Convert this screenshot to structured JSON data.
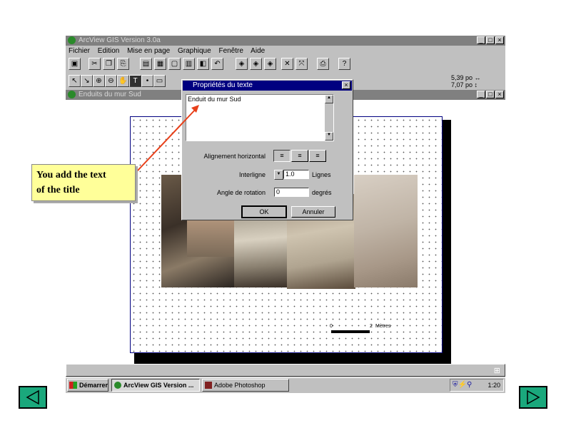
{
  "app": {
    "title": "ArcView GIS Version 3.0a",
    "menu": [
      "Fichier",
      "Edition",
      "Mise en page",
      "Graphique",
      "Fenêtre",
      "Aide"
    ],
    "window_buttons": [
      "_",
      "□",
      "×"
    ],
    "scale_readout": {
      "line1": "5,39 po ↔",
      "line2": "7,07 po ↕"
    }
  },
  "layout_window": {
    "title": "Enduits du mur Sud",
    "scale_bar": {
      "start": "0",
      "end": "2",
      "unit": "Mètres"
    }
  },
  "dialog": {
    "title": "Propriétés du texte",
    "text_value": "Enduit du mur Sud",
    "align_label": "Alignement horizontal",
    "linespacing_label": "Interligne",
    "linespacing_value": "1.0",
    "linespacing_unit": "Lignes",
    "rotation_label": "Angle de rotation",
    "rotation_value": "0",
    "rotation_unit": "degrés",
    "ok": "OK",
    "cancel": "Annuler"
  },
  "callout": {
    "line1": "You add the text",
    "line2": "of the title"
  },
  "taskbar": {
    "start": "Démarrer",
    "tasks": [
      "ArcView GIS Version ...",
      "Adobe Photoshop"
    ],
    "clock": "1:20"
  },
  "colors": {
    "titlebar": "#000080",
    "nav_button": "#1aa87c",
    "callout": "#ffff99",
    "arrow": "#e8401a"
  },
  "icons": [
    "app-icon",
    "save-icon",
    "cut-icon",
    "copy-icon",
    "paste-icon",
    "pointer-icon",
    "zoom-in-icon",
    "zoom-out-icon",
    "pan-icon",
    "text-tool-icon",
    "print-icon",
    "help-icon",
    "prev-slide-icon",
    "next-slide-icon"
  ]
}
